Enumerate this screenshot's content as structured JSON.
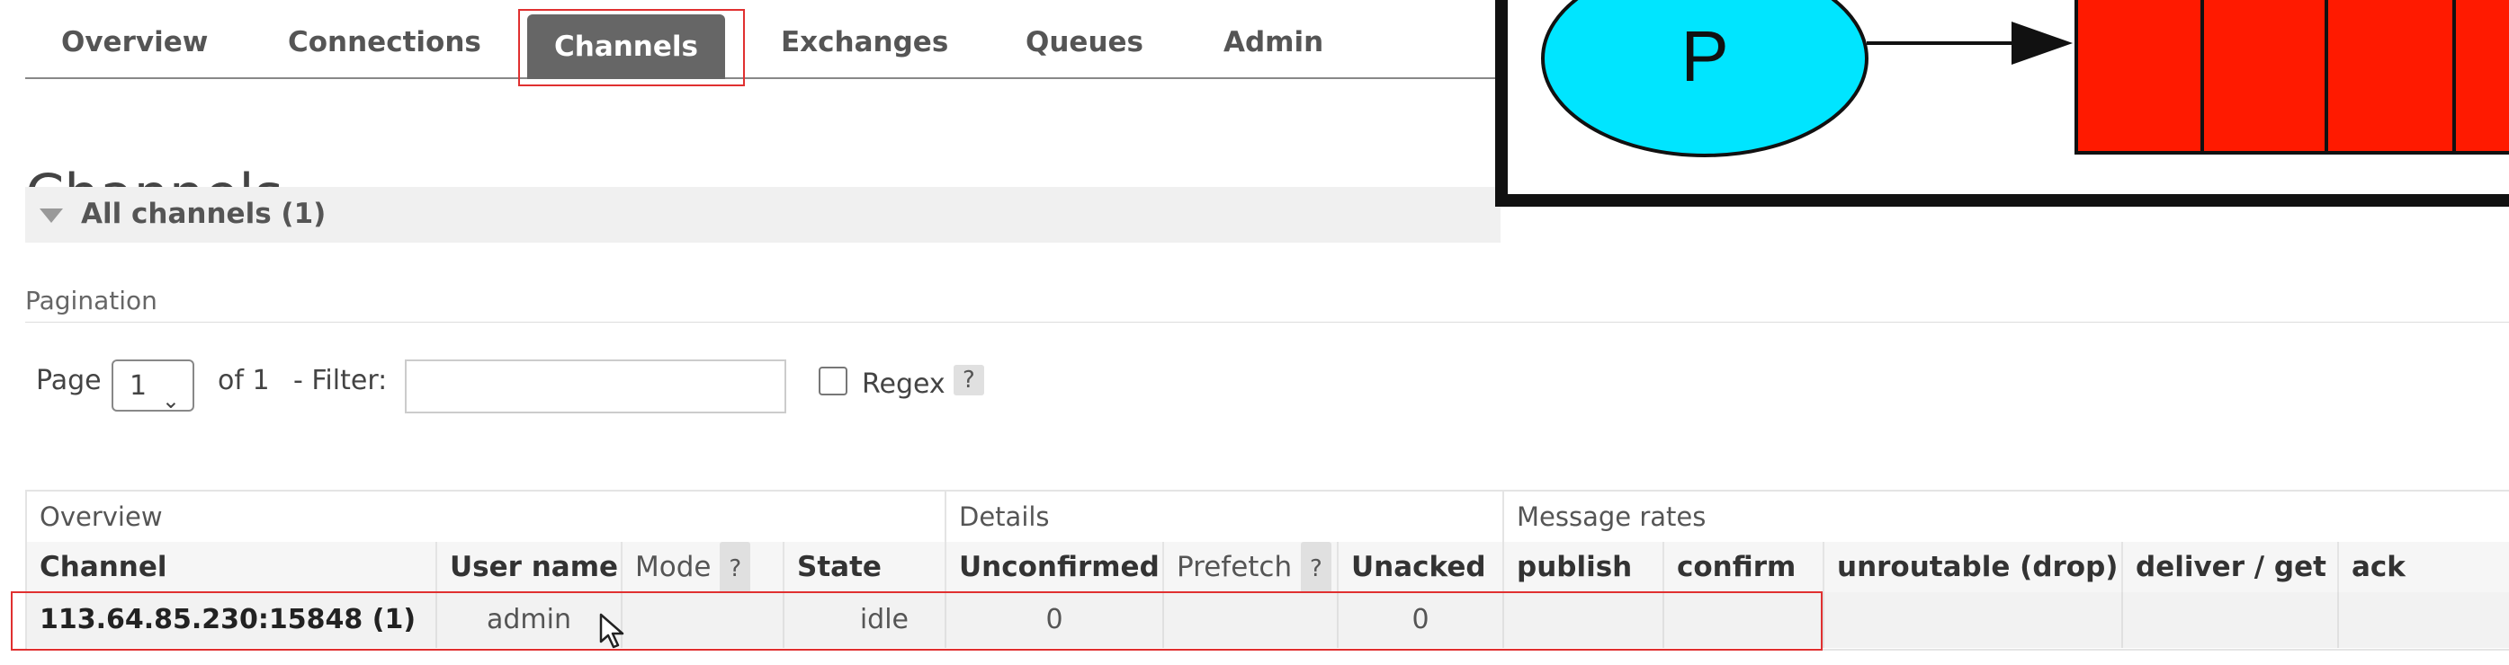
{
  "nav": {
    "tabs": [
      {
        "label": "Overview"
      },
      {
        "label": "Connections"
      },
      {
        "label": "Channels",
        "active": true
      },
      {
        "label": "Exchanges"
      },
      {
        "label": "Queues"
      },
      {
        "label": "Admin"
      }
    ]
  },
  "page": {
    "title": "Channels",
    "section_label": "All channels (1)"
  },
  "pagination": {
    "heading": "Pagination",
    "page_label": "Page",
    "page_value": "1",
    "of_label": "of 1",
    "filter_label": "- Filter:",
    "filter_value": "",
    "regex_label": "Regex",
    "help_glyph": "?"
  },
  "table": {
    "groups": [
      "Overview",
      "Details",
      "Message rates"
    ],
    "columns": [
      "Channel",
      "User name",
      "Mode",
      "State",
      "Unconfirmed",
      "Prefetch",
      "Unacked",
      "publish",
      "confirm",
      "unroutable (drop)",
      "deliver / get",
      "ack"
    ],
    "rows": [
      {
        "channel": "113.64.85.230:15848 (1)",
        "user": "admin",
        "mode": "",
        "state": "idle",
        "unconfirmed": "0",
        "prefetch": "",
        "unacked": "0",
        "publish": "",
        "confirm": "",
        "unroutable": "",
        "deliver_get": "",
        "ack": ""
      }
    ]
  },
  "diagram": {
    "producer_label": "P",
    "colors": {
      "producer": "#00e5ff",
      "queue": "#ff1a00",
      "outline": "#111111"
    }
  },
  "colors": {
    "active_tab": "#666666",
    "highlight": "#e03030"
  }
}
